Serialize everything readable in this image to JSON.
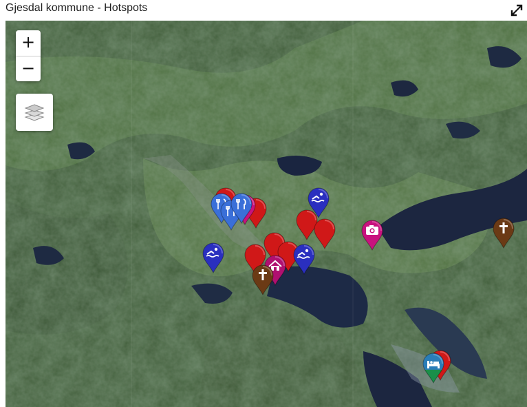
{
  "header": {
    "title": "Gjesdal kommune - Hotspots"
  },
  "controls": {
    "zoom_in_label": "+",
    "zoom_out_label": "−",
    "fullscreen_icon": "expand-icon",
    "layers_icon": "layers-icon"
  },
  "colors": {
    "red": "#d01818",
    "blue": "#2a2fbf",
    "light_blue": "#3a6fd8",
    "magenta": "#c8127e",
    "brown": "#6b3a15",
    "green": "#1a8f4a",
    "teal": "#2a7db8",
    "water": "#1e2a44",
    "forest": "#2f4a2c",
    "field": "#4f7a3e"
  },
  "markers": [
    {
      "category": "restaurant",
      "icon": "fork-knife-icon",
      "color": "#3a6fd8"
    },
    {
      "category": "restaurant",
      "icon": "fork-knife-icon",
      "color": "#3a6fd8"
    },
    {
      "category": "restaurant",
      "icon": "fork-knife-icon",
      "color": "#3a6fd8"
    },
    {
      "category": "swimming",
      "icon": "swimmer-icon",
      "color": "#2a2fbf"
    },
    {
      "category": "swimming",
      "icon": "swimmer-icon",
      "color": "#2a2fbf"
    },
    {
      "category": "swimming",
      "icon": "swimmer-icon",
      "color": "#2a2fbf"
    },
    {
      "category": "photo",
      "icon": "camera-icon",
      "color": "#c8127e"
    },
    {
      "category": "photo",
      "icon": "camera-icon",
      "color": "#c8127e"
    },
    {
      "category": "church",
      "icon": "cross-icon",
      "color": "#6b3a15"
    },
    {
      "category": "church",
      "icon": "cross-icon",
      "color": "#6b3a15"
    },
    {
      "category": "home",
      "icon": "house-icon",
      "color": "#b01070"
    },
    {
      "category": "hotel",
      "icon": "bed-icon",
      "color": "#1a8f4a"
    },
    {
      "category": "poi",
      "icon": "",
      "color": "#d01818"
    },
    {
      "category": "poi",
      "icon": "",
      "color": "#d01818"
    },
    {
      "category": "poi",
      "icon": "",
      "color": "#d01818"
    },
    {
      "category": "poi",
      "icon": "",
      "color": "#d01818"
    },
    {
      "category": "poi",
      "icon": "",
      "color": "#d01818"
    },
    {
      "category": "poi",
      "icon": "",
      "color": "#d01818"
    },
    {
      "category": "poi",
      "icon": "",
      "color": "#d01818"
    },
    {
      "category": "poi",
      "icon": "",
      "color": "#d01818"
    }
  ]
}
